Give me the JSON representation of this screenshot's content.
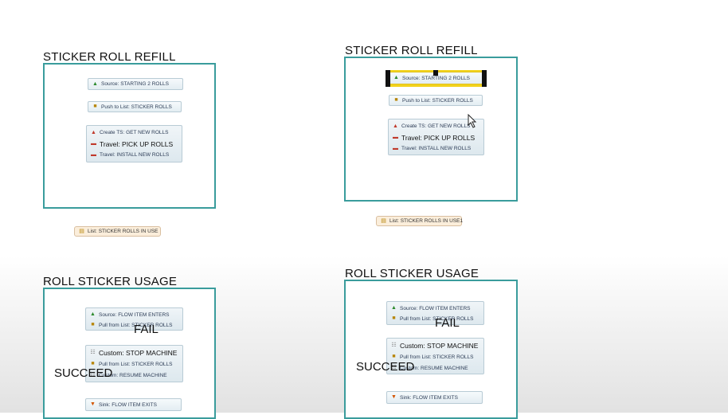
{
  "flows": [
    {
      "title": "STICKER ROLL REFILL",
      "nodes": {
        "source": "Source: STARTING 2 ROLLS",
        "push": "Push to List: STICKER ROLLS",
        "create_ts": "Create TS: GET NEW ROLLS",
        "travel_pick": "Travel: PICK UP ROLLS",
        "travel_install": "Travel: INSTALL NEW ROLLS"
      },
      "list_label": "List: STICKER ROLLS IN USE"
    },
    {
      "title": "STICKER ROLL REFILL",
      "nodes": {
        "source": "Source: STARTING 2 ROLLS",
        "push": "Push to List: STICKER ROLLS",
        "create_ts": "Create TS: GET NEW ROLLS",
        "travel_pick": "Travel: PICK UP ROLLS",
        "travel_install": "Travel: INSTALL NEW ROLLS"
      },
      "list_label": "List: STICKER ROLLS IN USE1"
    },
    {
      "title": "ROLL STICKER USAGE",
      "nodes": {
        "source": "Source: FLOW ITEM ENTERS",
        "pull": "Pull from List: STICKER ROLLS",
        "custom_stop": "Custom: STOP MACHINE",
        "pull2": "Pull from List: STICKER ROLLS",
        "custom_resume": "Custom: RESUME MACHINE",
        "sink": "Sink: FLOW ITEM EXITS"
      },
      "annotations": {
        "fail": "FAIL",
        "succeed": "SUCCEED"
      }
    },
    {
      "title": "ROLL STICKER USAGE",
      "nodes": {
        "source": "Source: FLOW ITEM ENTERS",
        "pull": "Pull from List: STICKER ROLLS",
        "custom_stop": "Custom: STOP MACHINE",
        "pull2": "Pull from List: STICKER ROLLS",
        "custom_resume": "Custom: RESUME MACHINE",
        "sink": "Sink: FLOW ITEM EXITS"
      },
      "annotations": {
        "fail": "FAIL",
        "succeed": "SUCCEED"
      }
    }
  ],
  "icons": {
    "source": "source-icon",
    "push_list": "list-push-icon",
    "pull_list": "list-pull-icon",
    "create_ts": "task-sequence-icon",
    "travel": "travel-truck-icon",
    "custom": "custom-code-icon",
    "sink": "sink-icon",
    "list": "list-icon"
  },
  "colors": {
    "frame_border": "#3a9c9c",
    "selection_yellow": "#f2d21b",
    "list_node_fill": "#fbeedb"
  }
}
